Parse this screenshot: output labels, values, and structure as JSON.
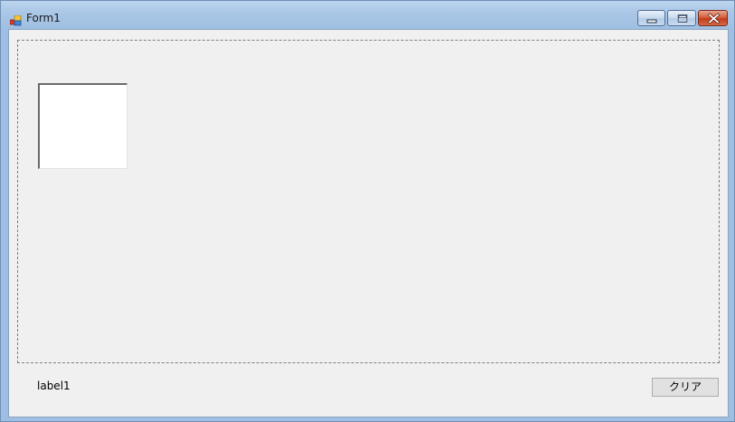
{
  "window": {
    "title": "Form1",
    "icon": "windows-forms-app-icon",
    "controls": {
      "minimize": "minimize-icon",
      "maximize": "maximize-icon",
      "close": "close-icon"
    }
  },
  "form": {
    "label1_text": "label1",
    "clear_button_label": "クリア"
  },
  "colors": {
    "client_background": "#f0f0f0",
    "picturebox_background": "#ffffff",
    "close_button": "#c94a2a",
    "titlebar": "#a9c6e6"
  }
}
